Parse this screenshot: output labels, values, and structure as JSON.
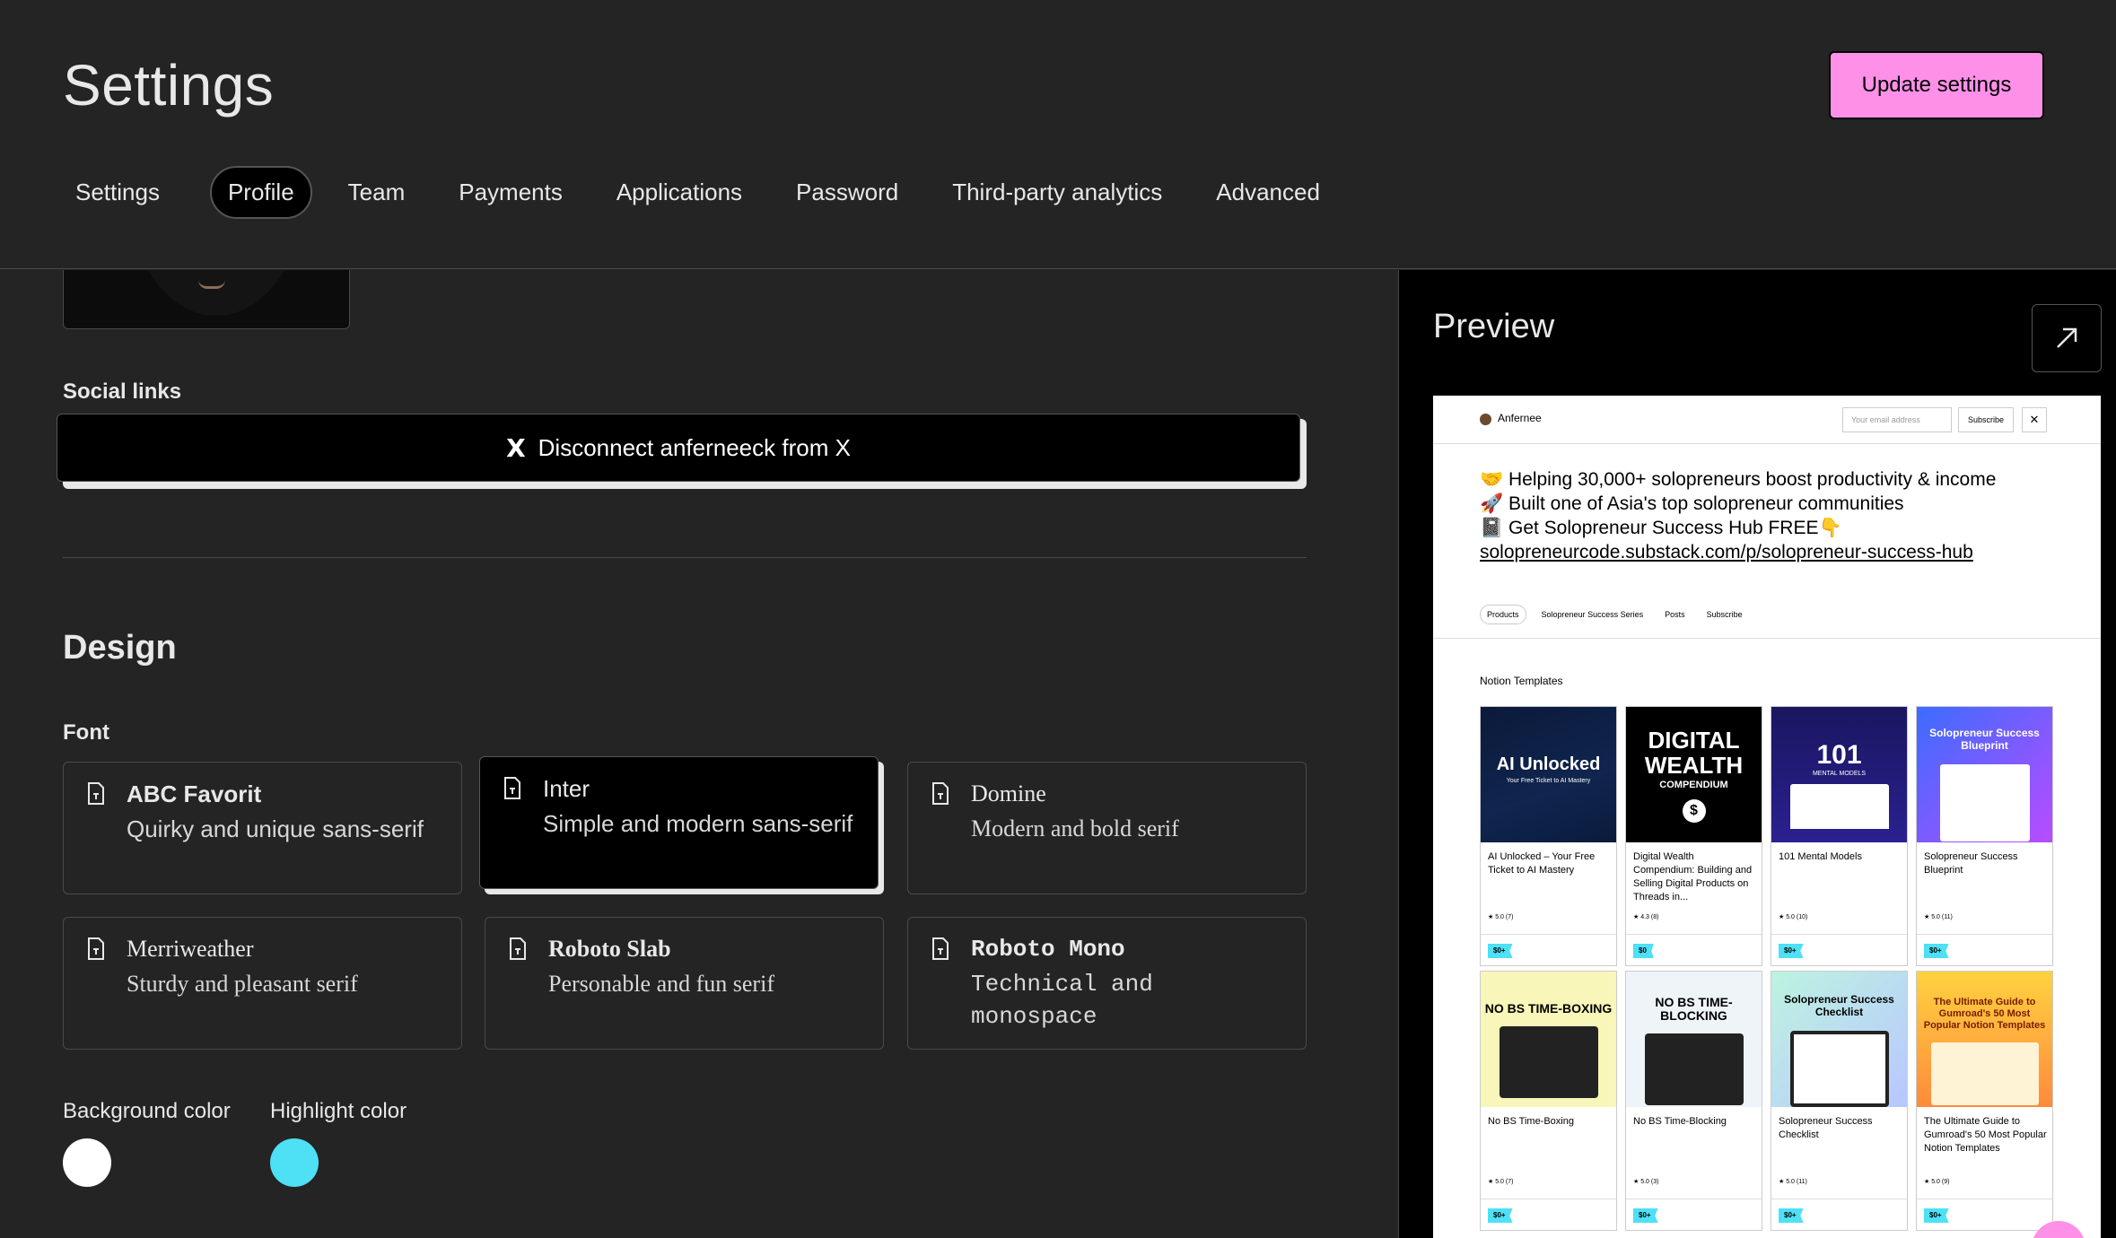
{
  "header": {
    "title": "Settings",
    "update_button": "Update settings",
    "tabs": [
      "Settings",
      "Profile",
      "Team",
      "Payments",
      "Applications",
      "Password",
      "Third-party analytics",
      "Advanced"
    ],
    "active_tab": "Profile"
  },
  "profile": {
    "social_links_label": "Social links",
    "x_button_icon": "X",
    "x_button_label": "Disconnect anferneeck from X"
  },
  "design": {
    "title": "Design",
    "font_label": "Font",
    "fonts": [
      {
        "name": "ABC Favorit",
        "desc": "Quirky and unique sans-serif"
      },
      {
        "name": "Inter",
        "desc": "Simple and modern sans-serif"
      },
      {
        "name": "Domine",
        "desc": "Modern and bold serif"
      },
      {
        "name": "Merriweather",
        "desc": "Sturdy and pleasant serif"
      },
      {
        "name": "Roboto Slab",
        "desc": "Personable and fun serif"
      },
      {
        "name": "Roboto Mono",
        "desc": "Technical and monospace"
      }
    ],
    "selected_font": "Inter",
    "background_color_label": "Background color",
    "highlight_color_label": "Highlight color",
    "background_color": "#ffffff",
    "highlight_color": "#4ee0f5"
  },
  "preview": {
    "title": "Preview",
    "expand_icon": "arrow-up-right-icon",
    "nav": {
      "name": "Anfernee",
      "email_placeholder": "Your email address",
      "subscribe": "Subscribe",
      "close": "✕"
    },
    "bio": [
      "🤝 Helping 30,000+ solopreneurs boost productivity & income",
      "🚀 Built one of Asia's top solopreneur communities",
      "📓 Get Solopreneur Success Hub FREE👇"
    ],
    "bio_link": "solopreneurcode.substack.com/p/solopreneur-success-hub",
    "tabs": [
      "Products",
      "Solopreneur Success Series",
      "Posts",
      "Subscribe"
    ],
    "section": "Notion Templates",
    "products": [
      {
        "title": "AI Unlocked – Your Free Ticket to AI Mastery",
        "rating": "★ 5.0 (7)",
        "price": "$0+",
        "thumb_big": "AI Unlocked",
        "thumb_small": "Your Free Ticket to AI Mastery"
      },
      {
        "title": "Digital Wealth Compendium: Building and Selling Digital Products on Threads in...",
        "rating": "★ 4.3 (8)",
        "price": "$0",
        "thumb_big": "DIGITAL WEALTH",
        "thumb_small": "COMPENDIUM"
      },
      {
        "title": "101 Mental Models",
        "rating": "★ 5.0 (10)",
        "price": "$0+",
        "thumb_big": "101",
        "thumb_small": "MENTAL MODELS"
      },
      {
        "title": "Solopreneur Success Blueprint",
        "rating": "★ 5.0 (11)",
        "price": "$0+",
        "thumb_big": "Solopreneur Success Blueprint",
        "thumb_small": ""
      },
      {
        "title": "No BS Time-Boxing",
        "rating": "★ 5.0 (7)",
        "price": "$0+",
        "thumb_big": "NO BS TIME-BOXING",
        "thumb_small": ""
      },
      {
        "title": "No BS Time-Blocking",
        "rating": "★ 5.0 (3)",
        "price": "$0+",
        "thumb_big": "NO BS TIME-BLOCKING",
        "thumb_small": ""
      },
      {
        "title": "Solopreneur Success Checklist",
        "rating": "★ 5.0 (11)",
        "price": "$0+",
        "thumb_big": "Solopreneur Success Checklist",
        "thumb_small": ""
      },
      {
        "title": "The Ultimate Guide to Gumroad's 50 Most Popular Notion Templates",
        "rating": "★ 5.0 (9)",
        "price": "$0+",
        "thumb_big": "The Ultimate Guide to Gumroad's 50 Most Popular Notion Templates",
        "thumb_small": ""
      }
    ]
  }
}
